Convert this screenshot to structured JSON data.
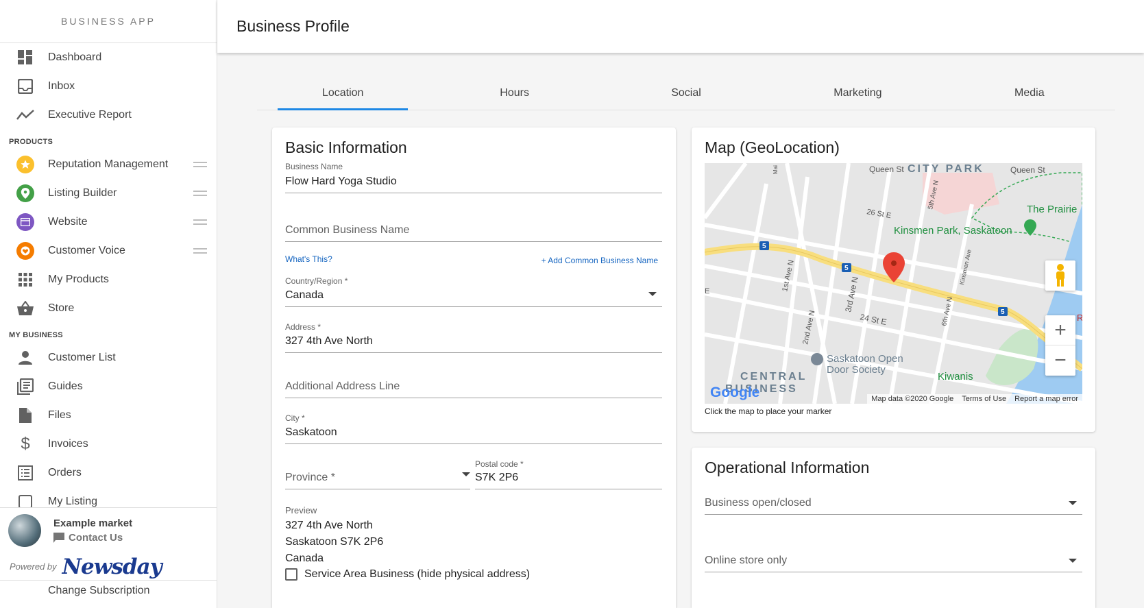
{
  "sidebar": {
    "app_title": "BUSINESS APP",
    "top_items": [
      {
        "label": "Dashboard",
        "icon": "dashboard-icon"
      },
      {
        "label": "Inbox",
        "icon": "inbox-icon"
      },
      {
        "label": "Executive Report",
        "icon": "trend-line-icon"
      }
    ],
    "products_header": "PRODUCTS",
    "products": [
      {
        "label": "Reputation Management",
        "icon": "star-icon",
        "color": "#fbc02d"
      },
      {
        "label": "Listing Builder",
        "icon": "location-pin-icon",
        "color": "#43a047"
      },
      {
        "label": "Website",
        "icon": "browser-icon",
        "color": "#7e57c2"
      },
      {
        "label": "Customer Voice",
        "icon": "heart-chat-icon",
        "color": "#f57c00"
      },
      {
        "label": "My Products",
        "icon": "apps-grid-icon"
      },
      {
        "label": "Store",
        "icon": "basket-icon"
      }
    ],
    "business_header": "MY BUSINESS",
    "business": [
      {
        "label": "Customer List",
        "icon": "person-icon"
      },
      {
        "label": "Guides",
        "icon": "guides-icon"
      },
      {
        "label": "Files",
        "icon": "file-icon"
      },
      {
        "label": "Invoices",
        "icon": "dollar-icon"
      },
      {
        "label": "Orders",
        "icon": "orders-list-icon"
      },
      {
        "label": "My Listing",
        "icon": "listing-icon"
      }
    ],
    "footer": {
      "market_name": "Example market",
      "contact_label": "Contact Us",
      "powered_by": "Powered by",
      "brand": "Newsday",
      "change_subscription": "Change Subscription"
    }
  },
  "header": {
    "title": "Business Profile"
  },
  "tabs": [
    {
      "label": "Location",
      "active": true
    },
    {
      "label": "Hours",
      "active": false
    },
    {
      "label": "Social",
      "active": false
    },
    {
      "label": "Marketing",
      "active": false
    },
    {
      "label": "Media",
      "active": false
    }
  ],
  "basic_info": {
    "title": "Basic Information",
    "business_name_label": "Business Name",
    "business_name_value": "Flow Hard Yoga Studio",
    "common_name_placeholder": "Common Business Name",
    "whats_this": "What's This?",
    "add_common_name": "+ Add Common Business Name",
    "country_label": "Country/Region *",
    "country_value": "Canada",
    "address_label": "Address *",
    "address_value": "327 4th Ave North",
    "additional_address_placeholder": "Additional Address Line",
    "city_label": "City *",
    "city_value": "Saskatoon",
    "province_placeholder": "Province *",
    "postal_label": "Postal code *",
    "postal_value": "S7K 2P6",
    "preview_label": "Preview",
    "preview_line1": "327 4th Ave North",
    "preview_line2": "Saskatoon S7K 2P6",
    "preview_line3": "Canada",
    "service_area_label": "Service Area Business (hide physical address)"
  },
  "map": {
    "title": "Map (GeoLocation)",
    "note": "Click the map to place your marker",
    "labels": {
      "queen_st_1": "Queen St",
      "city_park": "CITY PARK",
      "queen_st_2": "Queen St",
      "the_prairie": "The Prairie",
      "kinsmen_park": "Kinsmen Park, Saskatoon",
      "st_26": "26 St E",
      "st_24": "24 St E",
      "ave_1st": "1st Ave N",
      "ave_2nd": "2nd Ave N",
      "ave_3rd": "3rd Ave N",
      "ave_5th": "5th Ave N",
      "ave_6th": "6th Ave N",
      "kinsmen_ave": "Kinsmen Ave",
      "open_door": "Saskatoon Open",
      "open_door_2": "Door Society",
      "central": "CENTRAL",
      "business": "BUSINESS",
      "kiwanis": "Kiwanis",
      "route": "5",
      "edge_e": "E",
      "edge_r": "R",
      "mai": "Mai"
    },
    "attribution": {
      "data": "Map data ©2020 Google",
      "terms": "Terms of Use",
      "report": "Report a map error"
    },
    "google": "Google",
    "zoom_in": "+",
    "zoom_out": "−"
  },
  "operational": {
    "title": "Operational Information",
    "open_closed_placeholder": "Business open/closed",
    "online_store_placeholder": "Online store only"
  }
}
